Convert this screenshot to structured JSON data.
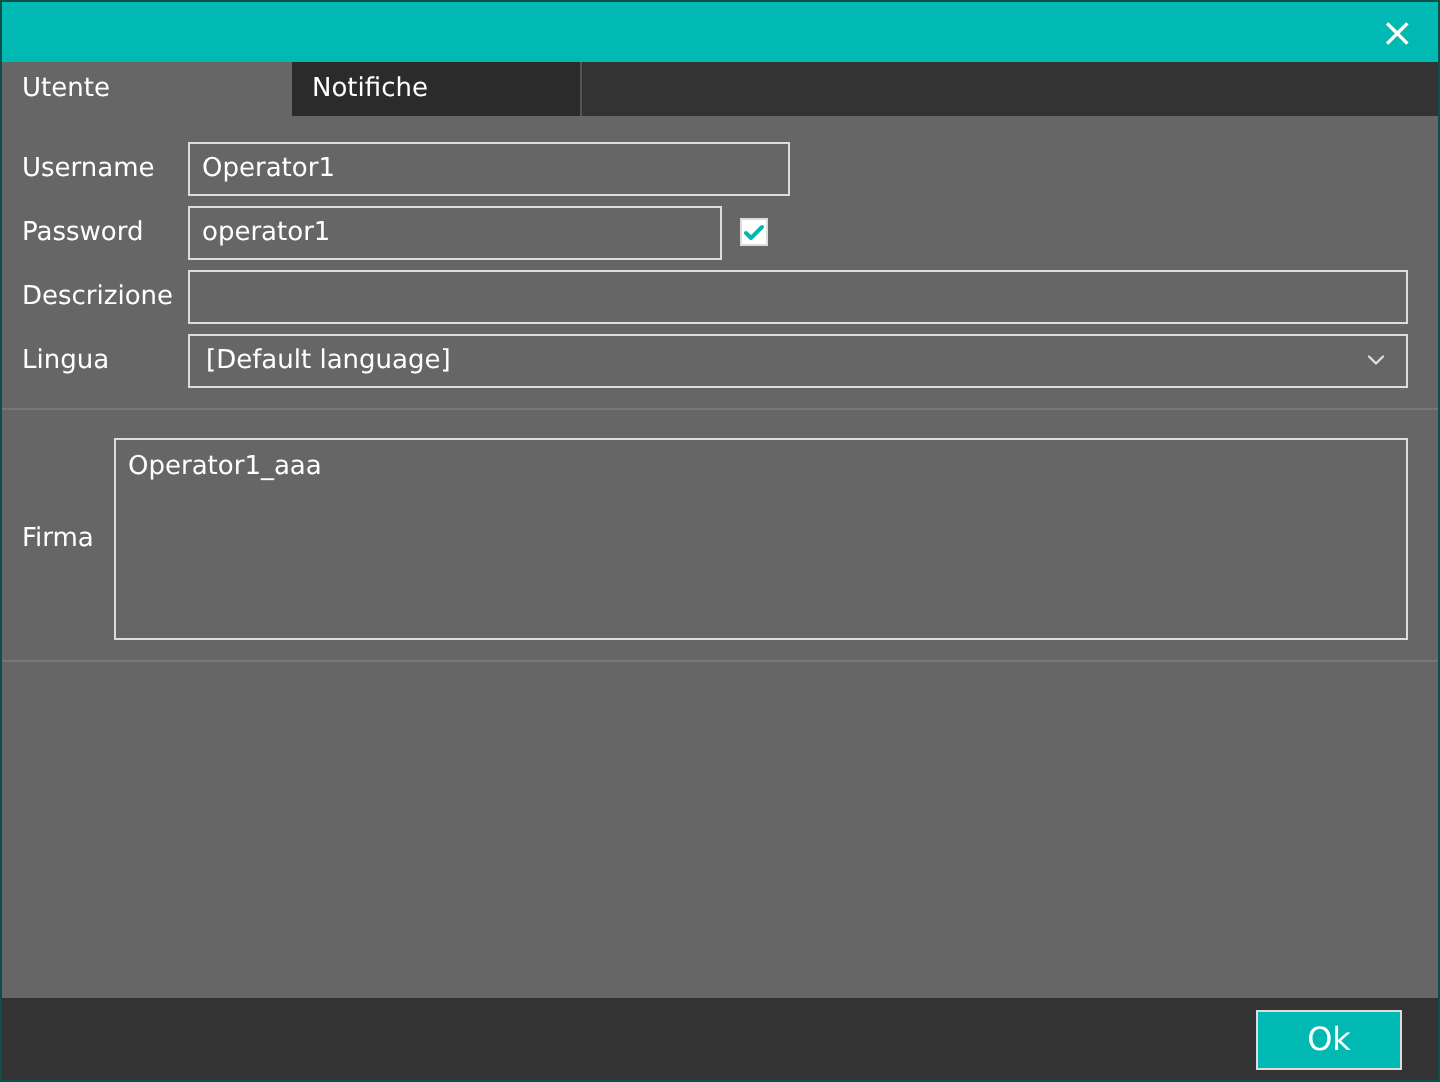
{
  "window": {
    "close": "×"
  },
  "tabs": [
    {
      "label": "Utente",
      "selected": true
    },
    {
      "label": "Notifiche",
      "selected": false
    }
  ],
  "fields": [
    {
      "kind": "text",
      "label": "Username",
      "value": "Operator1"
    },
    {
      "kind": "password",
      "label": "Password",
      "value": "operator1",
      "checked": true
    },
    {
      "kind": "text",
      "label": "Descrizione"
    },
    {
      "kind": "select",
      "label": "Lingua",
      "value": "[Default language]"
    }
  ],
  "signature": {
    "label": "Firma",
    "value": "Operator1_aaa"
  },
  "buttons": [
    "Ok"
  ]
}
